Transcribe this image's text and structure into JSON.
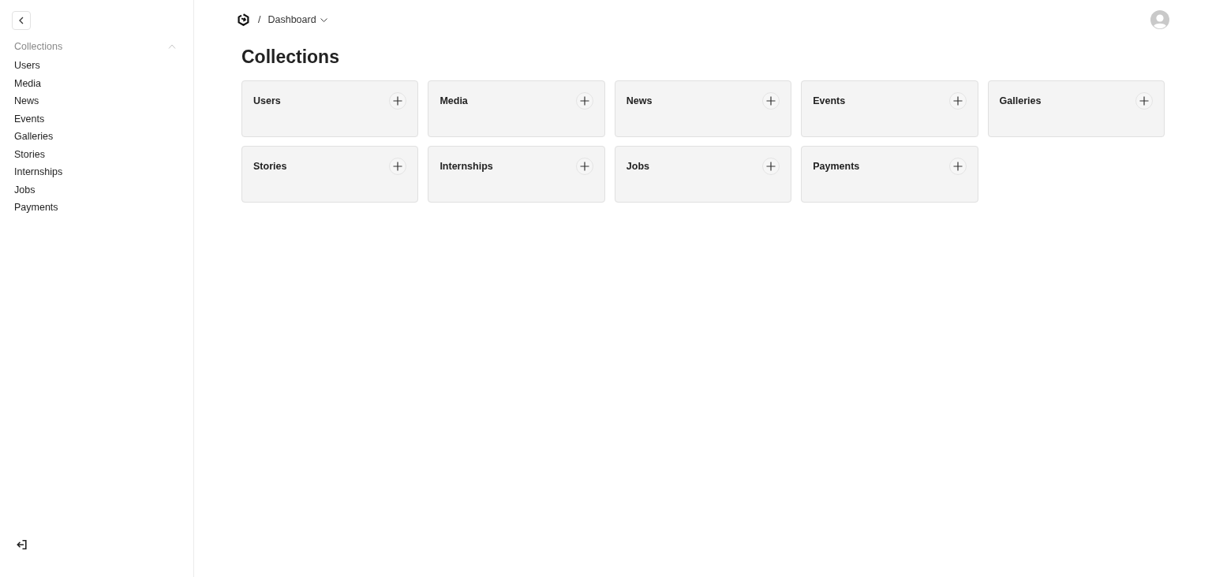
{
  "sidebar": {
    "section": {
      "title": "Collections",
      "expanded": true,
      "items": [
        "Users",
        "Media",
        "News",
        "Events",
        "Galleries",
        "Stories",
        "Internships",
        "Jobs",
        "Payments"
      ]
    }
  },
  "header": {
    "breadcrumb": {
      "separator": "/",
      "current": "Dashboard"
    }
  },
  "page": {
    "title": "Collections",
    "cards": [
      {
        "label": "Users"
      },
      {
        "label": "Media"
      },
      {
        "label": "News"
      },
      {
        "label": "Events"
      },
      {
        "label": "Galleries"
      },
      {
        "label": "Stories"
      },
      {
        "label": "Internships"
      },
      {
        "label": "Jobs"
      },
      {
        "label": "Payments"
      }
    ]
  }
}
